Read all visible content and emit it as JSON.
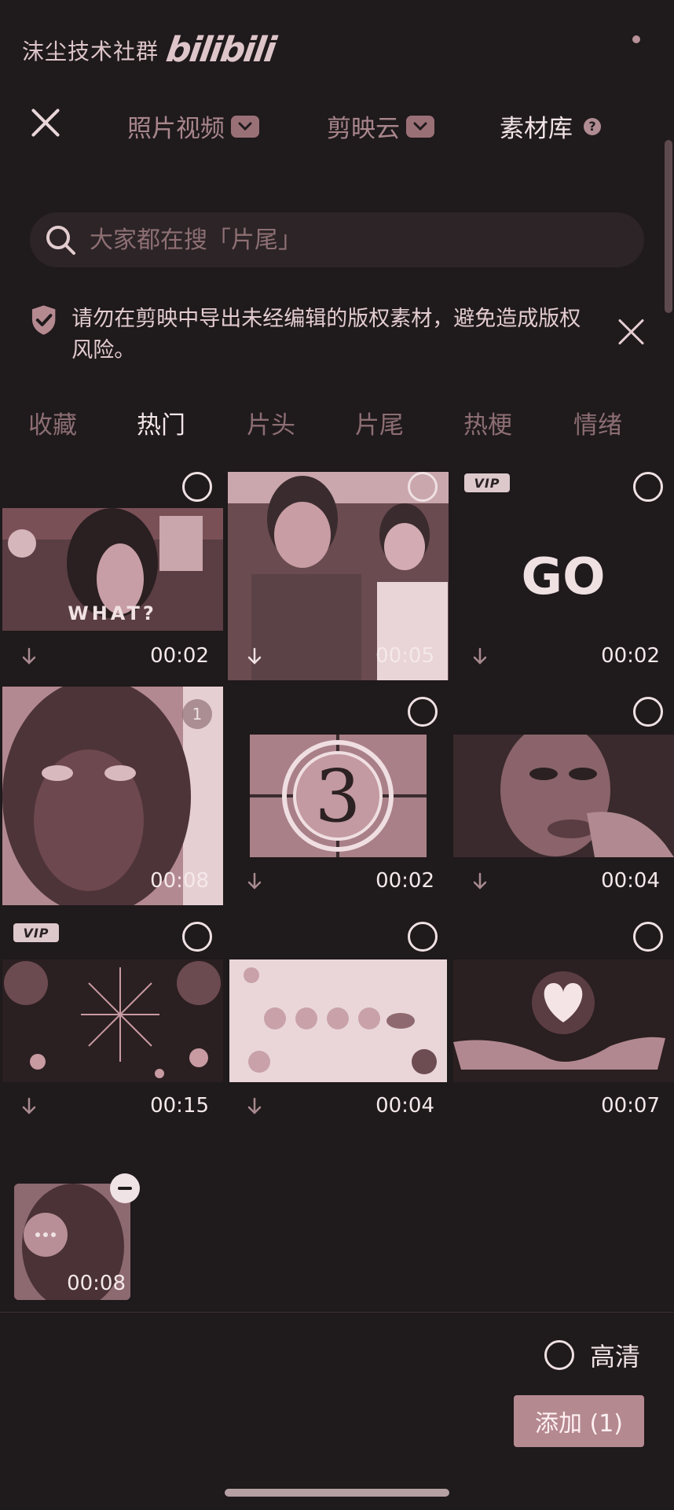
{
  "watermark": {
    "text": "沫尘技术社群",
    "logo": "bilibili"
  },
  "header": {
    "tabs": [
      {
        "label": "照片视频",
        "has_dropdown": true,
        "active": false
      },
      {
        "label": "剪映云",
        "has_dropdown": true,
        "active": false
      },
      {
        "label": "素材库",
        "has_help": true,
        "active": true
      }
    ],
    "help_glyph": "?"
  },
  "search": {
    "placeholder": "大家都在搜「片尾」"
  },
  "notice": {
    "text": "请勿在剪映中导出未经编辑的版权素材，避免造成版权风险。"
  },
  "categories": [
    {
      "label": "收藏",
      "active": false
    },
    {
      "label": "热门",
      "active": true
    },
    {
      "label": "片头",
      "active": false
    },
    {
      "label": "片尾",
      "active": false
    },
    {
      "label": "热梗",
      "active": false
    },
    {
      "label": "情绪",
      "active": false
    }
  ],
  "grid": [
    {
      "name": "what",
      "caption": "WHAT?",
      "duration": "00:02",
      "selected": false,
      "vip": false
    },
    {
      "name": "laughing-men",
      "caption": "",
      "duration": "00:05",
      "selected": false,
      "vip": false
    },
    {
      "name": "go",
      "caption": "GO",
      "duration": "00:02",
      "selected": false,
      "vip": true
    },
    {
      "name": "crying-face",
      "caption": "",
      "duration": "00:08",
      "selected": true,
      "selected_index": "1",
      "vip": false
    },
    {
      "name": "countdown-3",
      "caption": "3",
      "duration": "00:02",
      "selected": false,
      "vip": false
    },
    {
      "name": "smiling-man",
      "caption": "",
      "duration": "00:04",
      "selected": false,
      "vip": false
    },
    {
      "name": "fireworks",
      "caption": "",
      "duration": "00:15",
      "selected": false,
      "vip": true
    },
    {
      "name": "cute-stickers",
      "caption": "",
      "duration": "00:04",
      "selected": false,
      "vip": false
    },
    {
      "name": "heart-hands",
      "caption": "",
      "duration": "00:07",
      "selected": false,
      "vip": false
    }
  ],
  "vip_label": "VIP",
  "tray": {
    "duration": "00:08"
  },
  "footer": {
    "hd_label": "高清",
    "add_button": "添加 (1)"
  },
  "colors": {
    "background": "#1f1a1c",
    "accent": "#b58990",
    "muted": "#8c6e73",
    "text": "#e9d6d9"
  }
}
